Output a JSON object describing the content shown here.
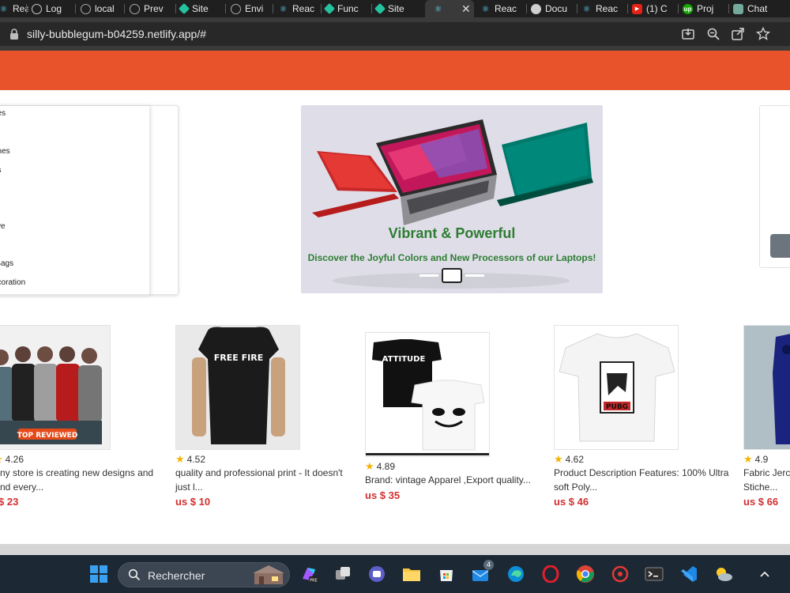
{
  "browser": {
    "tabs": [
      {
        "label": "Reac",
        "icon": "react-icon"
      },
      {
        "label": "Log",
        "icon": "github-icon"
      },
      {
        "label": "local",
        "icon": "globe-icon"
      },
      {
        "label": "Prev",
        "icon": "globe-icon"
      },
      {
        "label": "Site",
        "icon": "netlify-icon"
      },
      {
        "label": "Envi",
        "icon": "globe-icon"
      },
      {
        "label": "Reac",
        "icon": "react-icon"
      },
      {
        "label": "Func",
        "icon": "netlify-icon"
      },
      {
        "label": "Site",
        "icon": "netlify-icon"
      },
      {
        "label": "",
        "icon": "react-icon"
      },
      {
        "label": "Reac",
        "icon": "react-icon"
      },
      {
        "label": "Docu",
        "icon": "globe-icon"
      },
      {
        "label": "Reac",
        "icon": "react-icon"
      },
      {
        "label": "(1) C",
        "icon": "youtube-icon"
      },
      {
        "label": "Proj",
        "icon": "upwork-icon"
      },
      {
        "label": "Chat",
        "icon": "chatgpt-icon"
      }
    ],
    "url": "silly-bubblegum-b04259.netlify.app/#",
    "accent": "#e8532b"
  },
  "categories": [
    "ries",
    "",
    "ones",
    "es",
    "",
    "g",
    "tive",
    "",
    "-Bags",
    "ecoration"
  ],
  "banner": {
    "title": "Vibrant & Powerful",
    "subtitle": "Discover the Joyful Colors and New Processors of our Laptops!"
  },
  "products": [
    {
      "rating": "4.26",
      "desc_line1": "ny store is creating new designs and",
      "desc_line2": "nd every...",
      "price": "$ 23"
    },
    {
      "rating": "4.52",
      "desc_line1": "quality and professional print - It doesn't",
      "desc_line2": "just l...",
      "price": "us $ 10"
    },
    {
      "rating": "4.89",
      "desc_line1": "Brand: vintage Apparel ,Export quality...",
      "desc_line2": "",
      "price": "us $ 35"
    },
    {
      "rating": "4.62",
      "desc_line1": "Product Description Features: 100% Ultra",
      "desc_line2": "soft Poly...",
      "price": "us $ 46"
    },
    {
      "rating": "4.9",
      "desc_line1": "Fabric Jercy",
      "desc_line2": "Stiche...",
      "price": "us $ 66"
    }
  ],
  "product_image_text": {
    "p1_badge": "TOP REVIEWED",
    "p2_print": "FREE FIRE",
    "p3_print": "ATTITUDE",
    "p4_print": "PUBG"
  },
  "taskbar": {
    "search_label": "Rechercher",
    "mail_badge": "4"
  }
}
